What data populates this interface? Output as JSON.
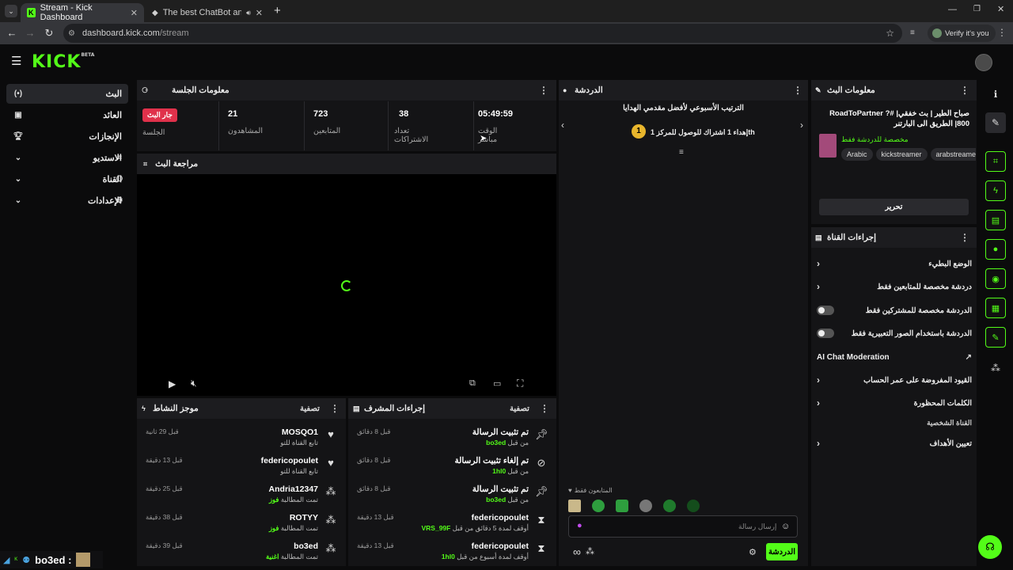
{
  "browser": {
    "tabs": [
      {
        "title": "Stream - Kick Dashboard",
        "favicon": "kick-icon"
      },
      {
        "title": "The best ChatBot and Widg",
        "favicon": "diamond-icon"
      }
    ],
    "new_tab": "+",
    "url_host": "dashboard.kick.com",
    "url_path": "/stream",
    "verify_label": "Verify it's you"
  },
  "header": {
    "logo": "KICK",
    "logo_badge": "BETA"
  },
  "sidebar": {
    "items": [
      {
        "label": "البث",
        "icon": "broadcast-icon"
      },
      {
        "label": "العائد",
        "icon": "wallet-icon"
      },
      {
        "label": "الإنجازات",
        "icon": "trophy-icon"
      },
      {
        "label": "الاستديو",
        "icon": "studio-icon"
      },
      {
        "label": "القناة",
        "icon": "users-icon"
      },
      {
        "label": "الإعدادات",
        "icon": "gear-icon"
      }
    ]
  },
  "session": {
    "title": "معلومات الجلسة",
    "stats": [
      {
        "value": "05:49:59",
        "label": "الوقت مباشر"
      },
      {
        "value": "38",
        "label": "تعداد الاشتراكات"
      },
      {
        "value": "723",
        "label": "المتابعين"
      },
      {
        "value": "21",
        "label": "المشاهدون"
      },
      {
        "value": "جار البث",
        "label": "الجلسة"
      }
    ]
  },
  "preview": {
    "title": "مراجعة البث"
  },
  "activity": {
    "title": "موجز النشاط",
    "filter": "تصفية",
    "rows": [
      {
        "name": "MOSQO1",
        "sub": "تابع القناة للتو",
        "sub_highlight": "",
        "time": "قبل 29 ثانية",
        "icon": "heart-icon"
      },
      {
        "name": "federicopoulet",
        "sub": "تابع القناة للتو",
        "sub_highlight": "",
        "time": "قبل 13 دقيقة",
        "icon": "heart-icon"
      },
      {
        "name": "Andria12347",
        "sub": "تمت المطالبة ",
        "sub_highlight": "فوز",
        "time": "قبل 25 دقيقة",
        "icon": "points-icon"
      },
      {
        "name": "ROTYY",
        "sub": "تمت المطالبة ",
        "sub_highlight": "فوز",
        "time": "قبل 38 دقيقة",
        "icon": "points-icon"
      },
      {
        "name": "bo3ed",
        "sub": "تمت المطالبة ",
        "sub_highlight": "اغنية",
        "time": "قبل 39 دقيقة",
        "icon": "points-icon"
      }
    ]
  },
  "modactions": {
    "title": "إجراءات المشرف",
    "filter": "تصفية",
    "rows": [
      {
        "name": "تم تثبيت الرسالة",
        "sub": "من قبل ",
        "sub_highlight": "bo3ed",
        "time": "قبل 8 دقائق",
        "icon": "pin-icon"
      },
      {
        "name": "تم إلغاء تثبيت الرسالة",
        "sub": "من قبل ",
        "sub_highlight": "1hl0",
        "time": "قبل 8 دقائق",
        "icon": "unpin-icon"
      },
      {
        "name": "تم تثبيت الرسالة",
        "sub": "من قبل ",
        "sub_highlight": "bo3ed",
        "time": "قبل 8 دقائق",
        "icon": "pin-icon"
      },
      {
        "name": "federicopoulet",
        "sub": "أوقف لمدة 5 دقائق من قبل ",
        "sub_highlight": "VRS_99F",
        "time": "قبل 13 دقيقة",
        "icon": "hourglass-icon"
      },
      {
        "name": "federicopoulet",
        "sub": "أوقف لمدة أسبوع من قبل ",
        "sub_highlight": "1hl0",
        "time": "قبل 13 دقيقة",
        "icon": "hourglass-icon"
      }
    ]
  },
  "chat": {
    "title": "الدردشة",
    "ranking_title": "الترتيب الأسبوعي لأفضل مقدمي الهدايا",
    "ranking_line": "إهداء 1 اشتراك للوصول للمركز 1th",
    "rank_number": "1",
    "followers_only": "المتابعون فقط",
    "input_placeholder": "إرسال رسالة",
    "send_label": "الدردشة"
  },
  "stream_info": {
    "title": "معلومات البث",
    "stream_title": "صباح الطير | بث خفقي| #RoadToPartner ?800| الطريق الى البارتنر",
    "category": "مخصصة للدردشة فقط",
    "tags": [
      "Arabic",
      "kickstreamer",
      "arabstreame"
    ],
    "edit_label": "تحرير"
  },
  "channel_actions": {
    "title": "إجراءات القناة",
    "items": [
      {
        "label": "الوضع البطيء",
        "control": "chevron"
      },
      {
        "label": "دردشة مخصصة للمتابعين فقط",
        "control": "chevron"
      },
      {
        "label": "الدردشة مخصصة للمشتركين فقط",
        "control": "toggle"
      },
      {
        "label": "الدردشة باستخدام الصور التعبيرية فقط",
        "control": "toggle"
      },
      {
        "label": "AI Chat Moderation",
        "control": "external"
      },
      {
        "label": "القيود المفروضة على عمر الحساب",
        "control": "chevron"
      },
      {
        "label": "الكلمات المحظورة",
        "control": "chevron"
      }
    ],
    "section_label": "القناة الشخصية",
    "goals_label": "تعيين الأهداف"
  },
  "overlay": {
    "username": "bo3ed :"
  },
  "colors": {
    "accent": "#53fc18",
    "live": "#e0314b"
  }
}
